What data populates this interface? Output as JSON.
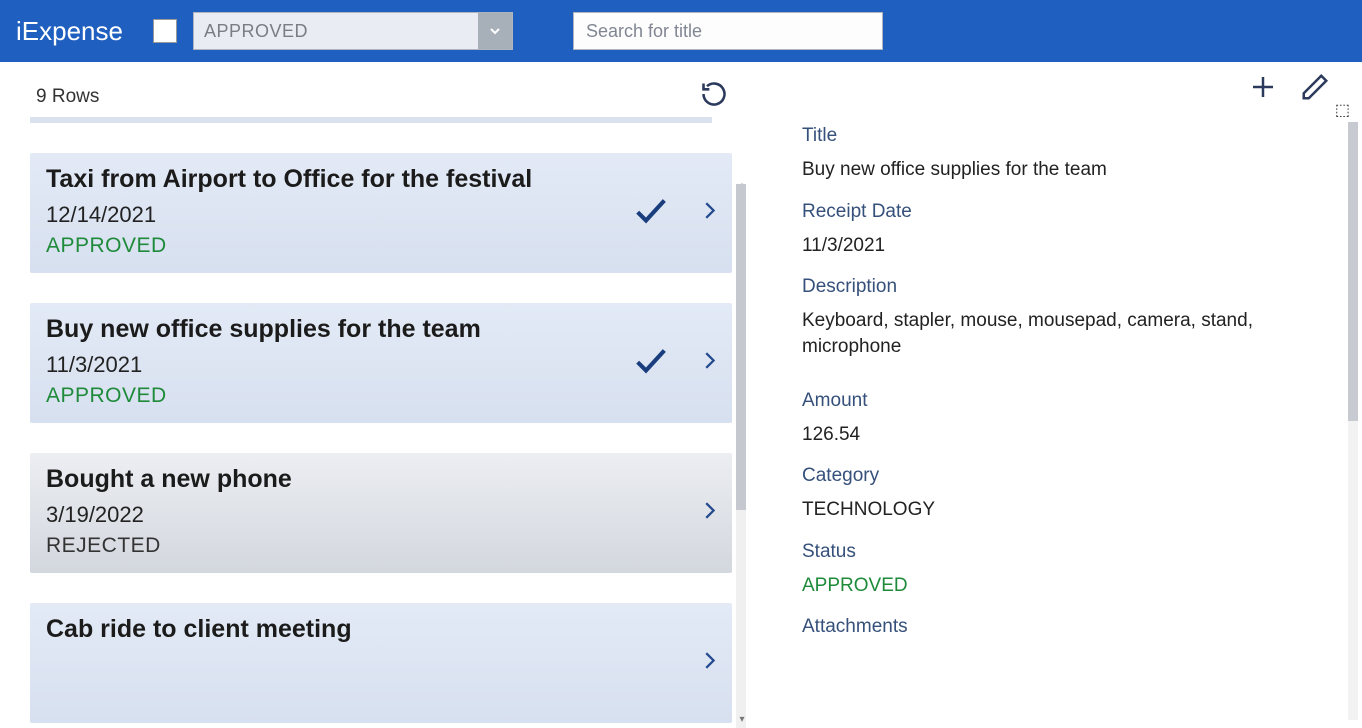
{
  "header": {
    "app_title": "iExpense",
    "filter_status": "APPROVED",
    "search_placeholder": "Search for title"
  },
  "list": {
    "row_count_label": "9 Rows",
    "items": [
      {
        "title": "Taxi from Airport to Office for the festival",
        "date": "12/14/2021",
        "status": "APPROVED",
        "approved": true
      },
      {
        "title": "Buy new office supplies for the team",
        "date": "11/3/2021",
        "status": "APPROVED",
        "approved": true
      },
      {
        "title": "Bought a new phone",
        "date": "3/19/2022",
        "status": "REJECTED",
        "approved": false
      },
      {
        "title": "Cab ride to client meeting",
        "date": "",
        "status": "",
        "approved": true
      }
    ]
  },
  "detail": {
    "labels": {
      "title": "Title",
      "receipt_date": "Receipt Date",
      "description": "Description",
      "amount": "Amount",
      "category": "Category",
      "status": "Status",
      "attachments": "Attachments"
    },
    "values": {
      "title": "Buy new office supplies for the team",
      "receipt_date": "11/3/2021",
      "description": "Keyboard, stapler, mouse, mousepad, camera, stand, microphone",
      "amount": "126.54",
      "category": "TECHNOLOGY",
      "status": "APPROVED"
    }
  }
}
